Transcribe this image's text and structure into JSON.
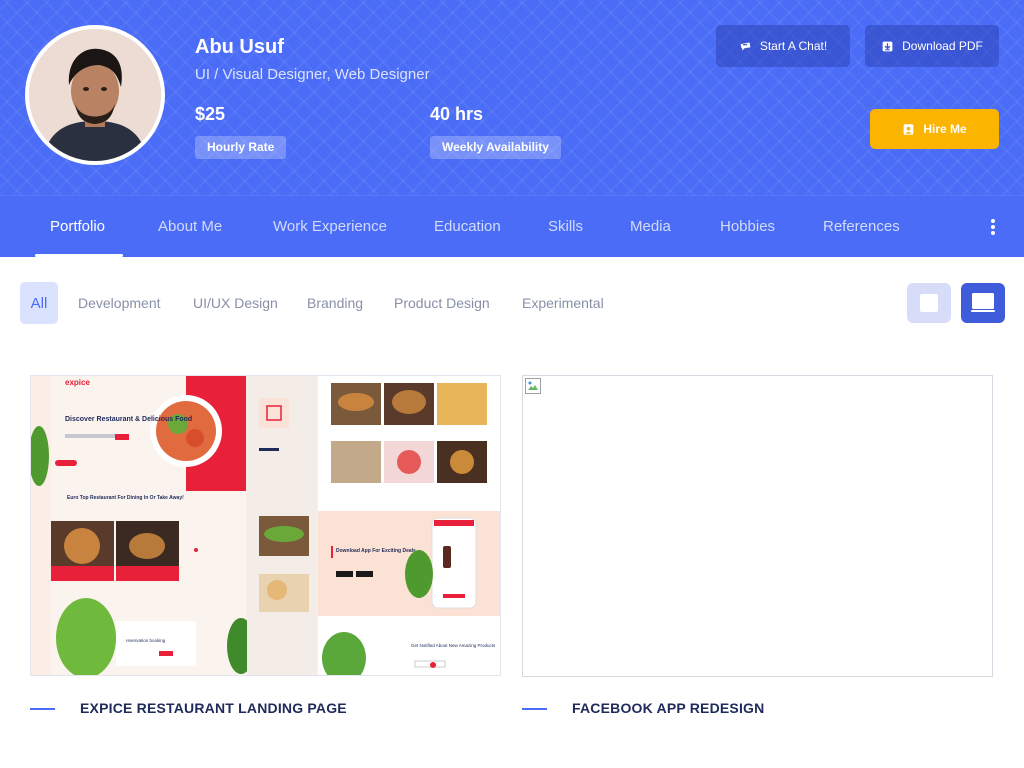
{
  "profile": {
    "name": "Abu Usuf",
    "title": "UI / Visual Designer, Web Designer",
    "rate_value": "$25",
    "rate_label": "Hourly Rate",
    "availability_value": "40 hrs",
    "availability_label": "Weekly Availability"
  },
  "actions": {
    "chat": "Start A Chat!",
    "download": "Download PDF",
    "hire": "Hire Me"
  },
  "nav": {
    "items": [
      "Portfolio",
      "About Me",
      "Work Experience",
      "Education",
      "Skills",
      "Media",
      "Hobbies",
      "References"
    ],
    "active": "Portfolio"
  },
  "filters": {
    "items": [
      "All",
      "Development",
      "UI/UX Design",
      "Branding",
      "Product Design",
      "Experimental"
    ],
    "active": "All"
  },
  "projects": [
    {
      "title": "EXPICE RESTAURANT LANDING PAGE",
      "brand": "expice",
      "hero_heading": "Discover Restaurant & Delicious Food",
      "section_heading": "Euro Top Restaurant For Dining In Or Take Away!",
      "app_heading": "Download App For Exciting Deals",
      "reservation": "reservation booking",
      "newsletter": "Get Notified About New Amazing Products"
    },
    {
      "title": "FACEBOOK APP REDESIGN"
    }
  ],
  "colors": {
    "primary": "#4a6cf7",
    "accent": "#fbb400",
    "heading": "#1f2a5a",
    "muted": "#8a8fa8"
  }
}
